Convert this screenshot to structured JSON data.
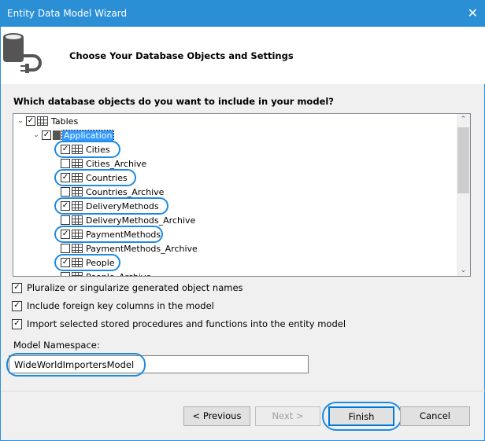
{
  "window": {
    "title": "Entity Data Model Wizard",
    "close_icon": "close-icon"
  },
  "header": {
    "title": "Choose Your Database Objects and Settings",
    "icon": "database-plug-icon"
  },
  "question": "Which database objects do you want to include in your model?",
  "tree": {
    "root": {
      "label": "Tables",
      "checked": true,
      "expanded": true
    },
    "schema": {
      "label": "Application",
      "checked": true,
      "expanded": true,
      "selected": true
    },
    "items": [
      {
        "label": "Cities",
        "checked": true,
        "highlighted": true
      },
      {
        "label": "Cities_Archive",
        "checked": false
      },
      {
        "label": "Countries",
        "checked": true,
        "highlighted": true
      },
      {
        "label": "Countries_Archive",
        "checked": false
      },
      {
        "label": "DeliveryMethods",
        "checked": true,
        "highlighted": true
      },
      {
        "label": "DeliveryMethods_Archive",
        "checked": false
      },
      {
        "label": "PaymentMethods",
        "checked": true,
        "highlighted": true
      },
      {
        "label": "PaymentMethods_Archive",
        "checked": false
      },
      {
        "label": "People",
        "checked": true,
        "highlighted": true
      },
      {
        "label": "People_Archive",
        "checked": false
      }
    ]
  },
  "options": [
    {
      "label": "Pluralize or singularize generated object names",
      "checked": true
    },
    {
      "label": "Include foreign key columns in the model",
      "checked": true
    },
    {
      "label": "Import selected stored procedures and functions into the entity model",
      "checked": true
    }
  ],
  "namespace": {
    "label": "Model Namespace:",
    "value": "WideWorldImportersModel"
  },
  "buttons": {
    "previous": "< Previous",
    "next": "Next >",
    "finish": "Finish",
    "cancel": "Cancel"
  },
  "colors": {
    "titlebar": "#2b8fd6",
    "annotation": "#1f8be0",
    "selection": "#3399ff"
  }
}
